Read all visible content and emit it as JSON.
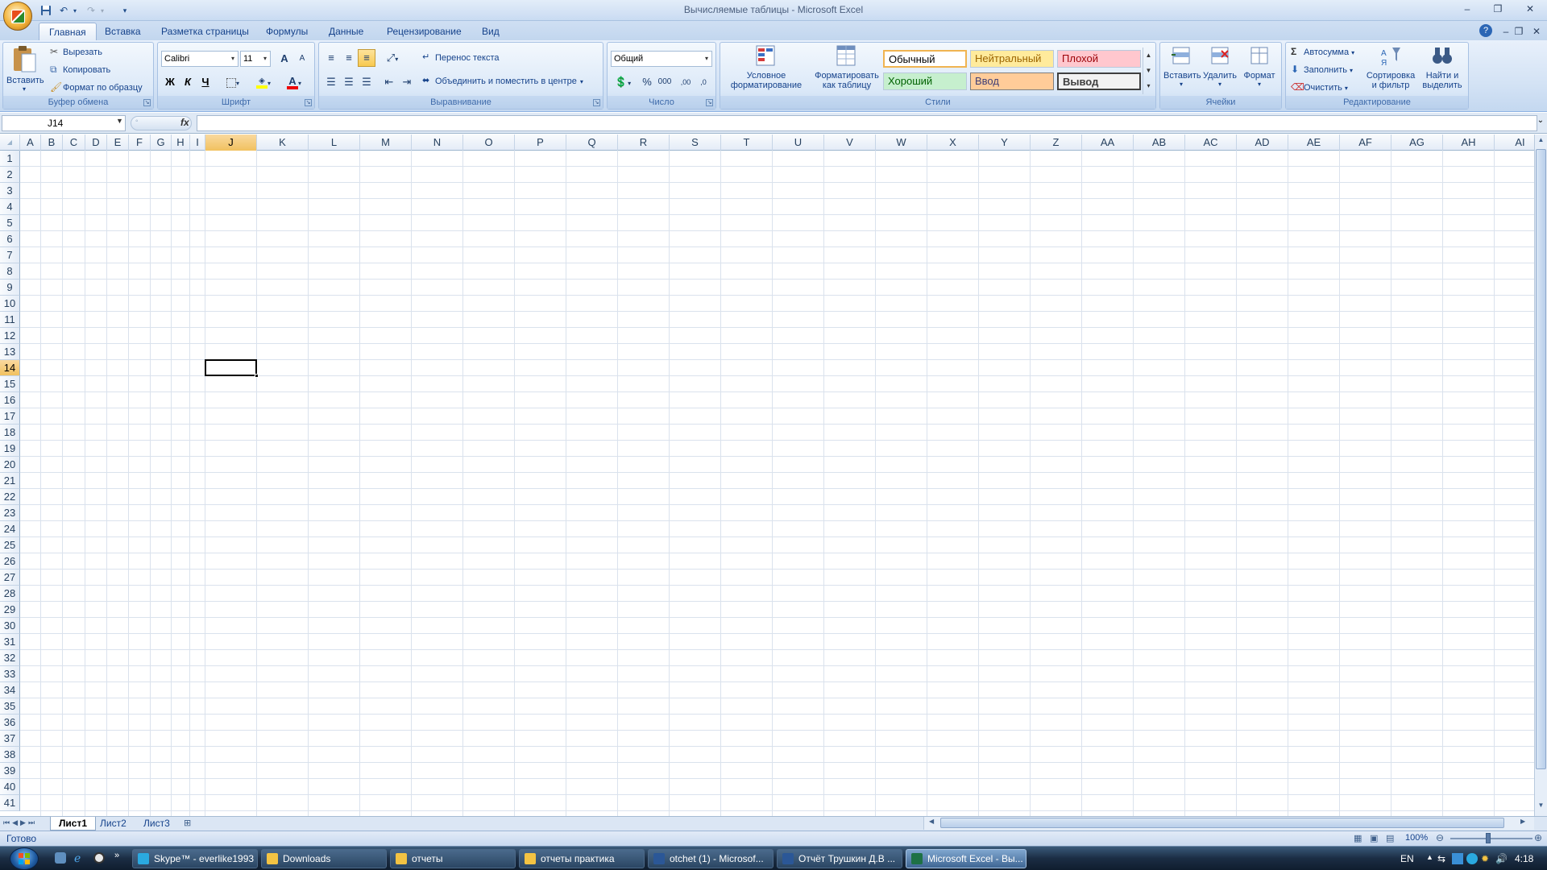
{
  "window": {
    "title": "Вычисляемые таблицы - Microsoft Excel",
    "min": "–",
    "restore": "❐",
    "close": "✕"
  },
  "quick_access": {
    "save": "💾",
    "undo": "↶",
    "redo": "↷",
    "customize": "▾"
  },
  "tabs": [
    "Главная",
    "Вставка",
    "Разметка страницы",
    "Формулы",
    "Данные",
    "Рецензирование",
    "Вид"
  ],
  "active_tab": "Главная",
  "ribbon": {
    "clipboard": {
      "paste": "Вставить",
      "cut": "Вырезать",
      "copy": "Копировать",
      "format_painter": "Формат по образцу",
      "label": "Буфер обмена"
    },
    "font": {
      "name": "Calibri",
      "size": "11",
      "bold": "Ж",
      "italic": "К",
      "underline": "Ч",
      "grow": "A",
      "shrink": "A",
      "label": "Шрифт"
    },
    "alignment": {
      "wrap": "Перенос текста",
      "merge": "Объединить и поместить в центре",
      "label": "Выравнивание"
    },
    "number": {
      "format": "Общий",
      "percent": "%",
      "thousands": "000",
      "inc_dec": ",00",
      "dec_dec": ",0",
      "label": "Число"
    },
    "styles": {
      "conditional": "Условное форматирование",
      "as_table": "Форматировать как таблицу",
      "normal": "Обычный",
      "neutral": "Нейтральный",
      "bad": "Плохой",
      "good": "Хороший",
      "input": "Ввод",
      "output": "Вывод",
      "label": "Стили"
    },
    "cells": {
      "insert": "Вставить",
      "delete": "Удалить",
      "format": "Формат",
      "label": "Ячейки"
    },
    "editing": {
      "autosum": "Автосумма",
      "fill": "Заполнить",
      "clear": "Очистить",
      "sort": "Сортировка и фильтр",
      "find": "Найти и выделить",
      "label": "Редактирование"
    }
  },
  "formula_bar": {
    "name_box": "J14",
    "fx": "fx",
    "value": ""
  },
  "grid": {
    "columns": [
      "A",
      "B",
      "C",
      "D",
      "E",
      "F",
      "G",
      "H",
      "I",
      "J",
      "K",
      "L",
      "M",
      "N",
      "O",
      "P",
      "Q",
      "R",
      "S",
      "T",
      "U",
      "V",
      "W",
      "X",
      "Y",
      "Z",
      "AA",
      "AB",
      "AC",
      "AD",
      "AE",
      "AF",
      "AG",
      "AH",
      "AI"
    ],
    "rows": [
      "1",
      "2",
      "3",
      "4",
      "5",
      "6",
      "7",
      "8",
      "9",
      "10",
      "11",
      "12",
      "13",
      "14",
      "15",
      "16",
      "17",
      "18",
      "19",
      "20",
      "21",
      "22",
      "23",
      "24",
      "25",
      "26",
      "27",
      "28",
      "29",
      "30",
      "31",
      "32",
      "33",
      "34",
      "35",
      "36",
      "37",
      "38",
      "39",
      "40",
      "41"
    ],
    "selected_column": "J",
    "selected_row": "14"
  },
  "sheets": [
    "Лист1",
    "Лист2",
    "Лист3"
  ],
  "active_sheet": "Лист1",
  "status": {
    "ready": "Готово",
    "zoom": "100%"
  },
  "taskbar": {
    "items": [
      {
        "label": "Skype™ - everlike1993",
        "icon_color": "#2aa9e0"
      },
      {
        "label": "Downloads",
        "icon_color": "#f3c343"
      },
      {
        "label": "отчеты",
        "icon_color": "#f3c343"
      },
      {
        "label": "отчеты практика",
        "icon_color": "#f3c343"
      },
      {
        "label": "otchet (1) - Microsof...",
        "icon_color": "#2b5797"
      },
      {
        "label": "Отчёт Трушкин Д.В ...",
        "icon_color": "#2b5797"
      },
      {
        "label": "Microsoft Excel - Вы...",
        "icon_color": "#1e7145"
      }
    ],
    "lang": "EN",
    "time": "4:18"
  },
  "colors": {
    "accent": "#15428b",
    "selection": "#f1c15f",
    "excel_green": "#1e7145"
  }
}
